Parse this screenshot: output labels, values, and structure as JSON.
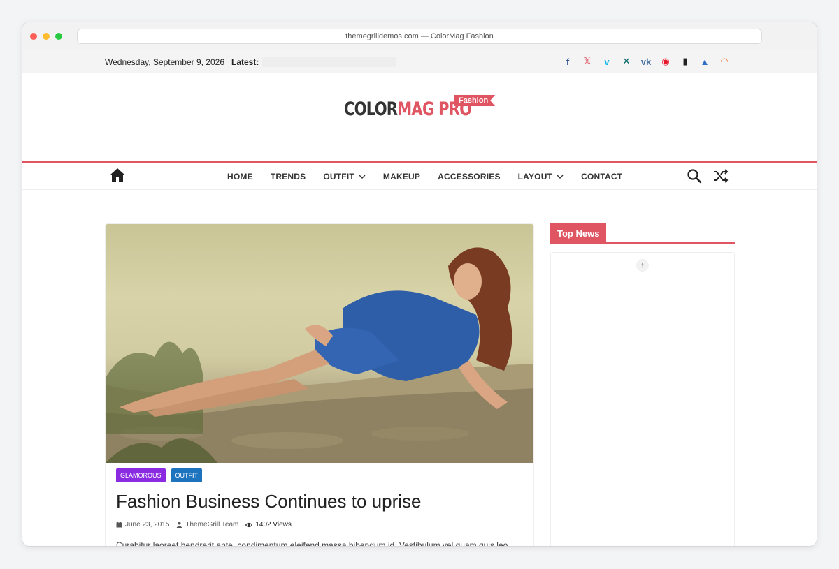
{
  "browser": {
    "url": "themegrilldemos.com — ColorMag Fashion"
  },
  "topbar": {
    "date": "Wednesday, September 9, 2026",
    "latest_label": "Latest:",
    "social": [
      {
        "icon": "facebook-icon",
        "glyph": "f",
        "color": "#3b5998"
      },
      {
        "icon": "x-twitter-icon",
        "glyph": "𝕏",
        "color": "#e05562"
      },
      {
        "icon": "vimeo-icon",
        "glyph": "v",
        "color": "#1ab7ea"
      },
      {
        "icon": "xing-icon",
        "glyph": "✕",
        "color": "#026466"
      },
      {
        "icon": "vk-icon",
        "glyph": "vk",
        "color": "#4c75a3"
      },
      {
        "icon": "weibo-icon",
        "glyph": "◉",
        "color": "#e6162d"
      },
      {
        "icon": "book-icon",
        "glyph": "▮",
        "color": "#222222"
      },
      {
        "icon": "ello-icon",
        "glyph": "▲",
        "color": "#2d6ec4"
      },
      {
        "icon": "rss-icon",
        "glyph": "◠",
        "color": "#f26522"
      }
    ]
  },
  "header": {
    "logo_part1": "COLOR",
    "logo_part2": "MAG PRO",
    "logo_tag": "Fashion",
    "accent": "#e05562"
  },
  "nav": {
    "items": [
      {
        "label": "HOME",
        "dropdown": false
      },
      {
        "label": "TRENDS",
        "dropdown": false
      },
      {
        "label": "OUTFIT",
        "dropdown": true
      },
      {
        "label": "MAKEUP",
        "dropdown": false
      },
      {
        "label": "ACCESSORIES",
        "dropdown": false
      },
      {
        "label": "LAYOUT",
        "dropdown": true
      },
      {
        "label": "CONTACT",
        "dropdown": false
      }
    ]
  },
  "post": {
    "tags": [
      {
        "label": "GLAMOROUS",
        "color": "#8a2be2"
      },
      {
        "label": "OUTFIT",
        "color": "#1e73be"
      }
    ],
    "title": "Fashion Business Continues to uprise",
    "date": "June 23, 2015",
    "author": "ThemeGrill Team",
    "views": "1402 Views",
    "excerpt": "Curabitur laoreet hendrerit ante, condimentum eleifend massa bibendum id. Vestibulum vel quam quis leo"
  },
  "sidebar": {
    "widget_title": "Top News"
  }
}
